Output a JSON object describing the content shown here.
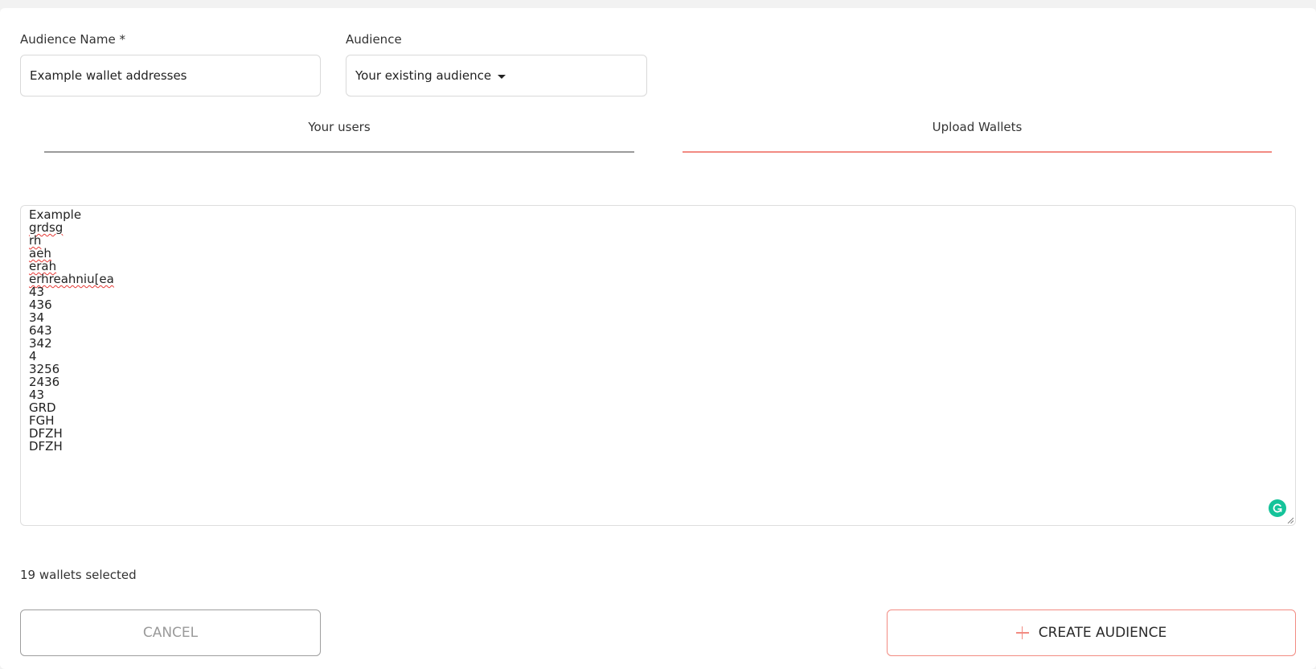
{
  "form": {
    "audience_name_label": "Audience Name *",
    "audience_name_value": "Example wallet addresses",
    "audience_label": "Audience",
    "audience_selected": "Your existing audience"
  },
  "tabs": [
    {
      "label": "Your users",
      "active": false
    },
    {
      "label": "Upload Wallets",
      "active": true
    }
  ],
  "wallets": {
    "lines": [
      "Example",
      "grdsg",
      "rh",
      "aeh",
      "erah",
      "erhreahniu[ea",
      "43",
      "436",
      "34",
      "643",
      "342",
      "4",
      "3256",
      "2436",
      "43",
      "GRD",
      "FGH",
      "DFZH",
      "DFZH"
    ],
    "count_text": "19 wallets selected"
  },
  "buttons": {
    "cancel_label": "CANCEL",
    "create_label": "CREATE AUDIENCE"
  },
  "colors": {
    "accent": "#f28b82",
    "grammarly": "#15c39a",
    "inactive_tab": "#9a9a9a"
  },
  "icons": {
    "grammarly": "grammarly-icon",
    "create": "plus-icon",
    "dropdown": "caret-down-icon"
  }
}
